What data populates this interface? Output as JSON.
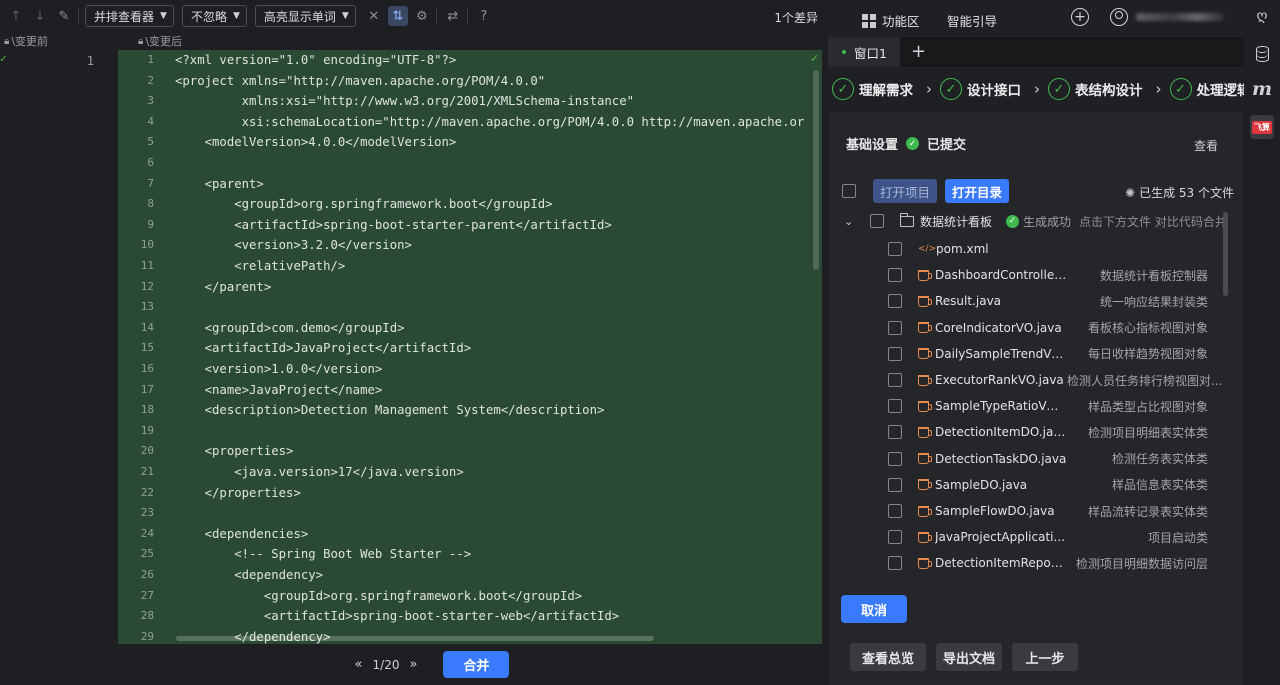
{
  "toolbar": {
    "viewer_select": "并排查看器",
    "ignore_select": "不忽略",
    "highlight_select": "高亮显示单词",
    "diff_count": "1个差异"
  },
  "headers": {
    "before": "\\变更前",
    "after": "\\变更后"
  },
  "left_line_number": "1",
  "code_lines": [
    {
      "n": "1",
      "t": "<?xml version=\"1.0\" encoding=\"UTF-8\"?>"
    },
    {
      "n": "2",
      "t": "<project xmlns=\"http://maven.apache.org/POM/4.0.0\""
    },
    {
      "n": "3",
      "t": "         xmlns:xsi=\"http://www.w3.org/2001/XMLSchema-instance\""
    },
    {
      "n": "4",
      "t": "         xsi:schemaLocation=\"http://maven.apache.org/POM/4.0.0 http://maven.apache.or"
    },
    {
      "n": "5",
      "t": "    <modelVersion>4.0.0</modelVersion>"
    },
    {
      "n": "6",
      "t": ""
    },
    {
      "n": "7",
      "t": "    <parent>"
    },
    {
      "n": "8",
      "t": "        <groupId>org.springframework.boot</groupId>"
    },
    {
      "n": "9",
      "t": "        <artifactId>spring-boot-starter-parent</artifactId>"
    },
    {
      "n": "10",
      "t": "        <version>3.2.0</version>"
    },
    {
      "n": "11",
      "t": "        <relativePath/>"
    },
    {
      "n": "12",
      "t": "    </parent>"
    },
    {
      "n": "13",
      "t": ""
    },
    {
      "n": "14",
      "t": "    <groupId>com.demo</groupId>"
    },
    {
      "n": "15",
      "t": "    <artifactId>JavaProject</artifactId>"
    },
    {
      "n": "16",
      "t": "    <version>1.0.0</version>"
    },
    {
      "n": "17",
      "t": "    <name>JavaProject</name>"
    },
    {
      "n": "18",
      "t": "    <description>Detection Management System</description>"
    },
    {
      "n": "19",
      "t": ""
    },
    {
      "n": "20",
      "t": "    <properties>"
    },
    {
      "n": "21",
      "t": "        <java.version>17</java.version>"
    },
    {
      "n": "22",
      "t": "    </properties>"
    },
    {
      "n": "23",
      "t": ""
    },
    {
      "n": "24",
      "t": "    <dependencies>"
    },
    {
      "n": "25",
      "t": "        <!-- Spring Boot Web Starter -->"
    },
    {
      "n": "26",
      "t": "        <dependency>"
    },
    {
      "n": "27",
      "t": "            <groupId>org.springframework.boot</groupId>"
    },
    {
      "n": "28",
      "t": "            <artifactId>spring-boot-starter-web</artifactId>"
    },
    {
      "n": "29",
      "t": "        </dependency>"
    }
  ],
  "footer": {
    "page": "1/20",
    "merge_label": "合并"
  },
  "nav": {
    "func_area": "功能区",
    "smart_guide": "智能引导"
  },
  "tabs": [
    {
      "label": "窗口1"
    }
  ],
  "steps": [
    {
      "label": "理解需求"
    },
    {
      "label": "设计接口"
    },
    {
      "label": "表结构设计"
    },
    {
      "label": "处理逻辑"
    }
  ],
  "basic": {
    "title": "基础设置",
    "status": "已提交",
    "view_link": "查看"
  },
  "actions": {
    "open_project": "打开项目",
    "open_dir": "打开目录",
    "generated": "已生成 53 个文件"
  },
  "folder": {
    "name": "数据统计看板",
    "status": "生成成功",
    "hint": "点击下方文件 对比代码合并"
  },
  "files": [
    {
      "name": "pom.xml",
      "desc": "",
      "type": "xml"
    },
    {
      "name": "DashboardController....",
      "desc": "数据统计看板控制器",
      "type": "java"
    },
    {
      "name": "Result.java",
      "desc": "统一响应结果封装类",
      "type": "java"
    },
    {
      "name": "CoreIndicatorVO.java",
      "desc": "看板核心指标视图对象",
      "type": "java"
    },
    {
      "name": "DailySampleTrendVO.j...",
      "desc": "每日收样趋势视图对象",
      "type": "java"
    },
    {
      "name": "ExecutorRankVO.java",
      "desc": "检测人员任务排行榜视图对...",
      "type": "java"
    },
    {
      "name": "SampleTypeRatioVO.ja...",
      "desc": "样品类型占比视图对象",
      "type": "java"
    },
    {
      "name": "DetectionItemDO.java",
      "desc": "检测项目明细表实体类",
      "type": "java"
    },
    {
      "name": "DetectionTaskDO.java",
      "desc": "检测任务表实体类",
      "type": "java"
    },
    {
      "name": "SampleDO.java",
      "desc": "样品信息表实体类",
      "type": "java"
    },
    {
      "name": "SampleFlowDO.java",
      "desc": "样品流转记录表实体类",
      "type": "java"
    },
    {
      "name": "JavaProjectApplicati...",
      "desc": "项目启动类",
      "type": "java"
    },
    {
      "name": "DetectionItemReposit...",
      "desc": "检测项目明细数据访问层",
      "type": "java"
    }
  ],
  "buttons": {
    "cancel": "取消",
    "overview": "查看总览",
    "export": "导出文档",
    "prev": "上一步"
  },
  "rail": {
    "fei_label": "飞算"
  },
  "colors": {
    "accent": "#3a7afe",
    "success": "#3fb950",
    "diff_bg": "#2b4a33"
  }
}
